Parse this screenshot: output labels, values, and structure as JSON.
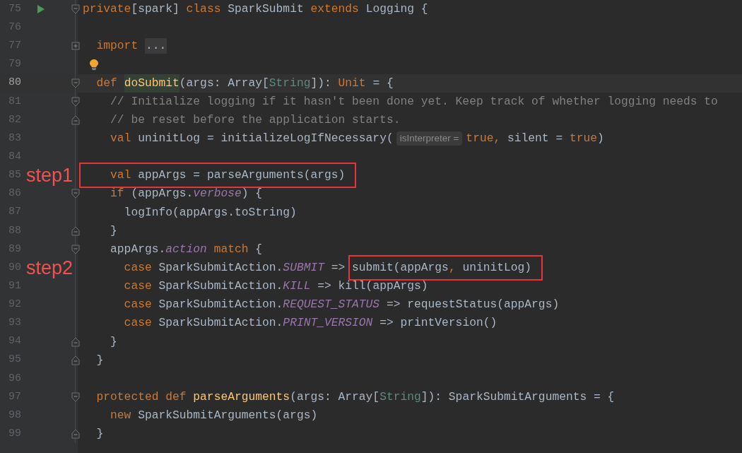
{
  "editor": {
    "lines": [
      {
        "number": "75",
        "current": false,
        "gutter_icon": {
          "kind": "run"
        },
        "fold": {
          "kind": "start"
        },
        "tokens": [
          {
            "kind": "kw",
            "text": "private"
          },
          {
            "kind": "plain",
            "text": "[spark] "
          },
          {
            "kind": "kw",
            "text": "class "
          },
          {
            "kind": "plain",
            "text": "SparkSubmit "
          },
          {
            "kind": "kw",
            "text": "extends "
          },
          {
            "kind": "plain",
            "text": "Logging {"
          }
        ]
      },
      {
        "number": "76",
        "current": false
      },
      {
        "number": "77",
        "current": false,
        "fold": {
          "kind": "collapsed"
        },
        "tokens": [
          {
            "kind": "kw",
            "text": "  import "
          },
          {
            "kind": "folded",
            "text": "..."
          }
        ]
      },
      {
        "number": "79",
        "current": false,
        "code_icon": {
          "kind": "bulb"
        }
      },
      {
        "number": "80",
        "current": true,
        "fold": {
          "kind": "start"
        },
        "tokens": [
          {
            "kind": "kw",
            "text": "  def "
          },
          {
            "kind": "decl",
            "text": "doSubmit",
            "highlighted": true
          },
          {
            "kind": "plain",
            "text": "(args: Array["
          },
          {
            "kind": "type",
            "text": "String"
          },
          {
            "kind": "plain",
            "text": "]): "
          },
          {
            "kind": "kw",
            "text": "Unit"
          },
          {
            "kind": "plain",
            "text": " = {"
          }
        ]
      },
      {
        "number": "81",
        "current": false,
        "fold": {
          "kind": "start"
        },
        "tokens": [
          {
            "kind": "comment",
            "text": "    // Initialize logging if it hasn't been done yet. Keep track of whether logging needs to"
          }
        ]
      },
      {
        "number": "82",
        "current": false,
        "fold": {
          "kind": "end"
        },
        "tokens": [
          {
            "kind": "comment",
            "text": "    // be reset before the application starts."
          }
        ]
      },
      {
        "number": "83",
        "current": false,
        "tokens": [
          {
            "kind": "kw",
            "text": "    val "
          },
          {
            "kind": "plain",
            "text": "uninitLog = initializeLogIfNecessary("
          },
          {
            "kind": "hint",
            "text": "isInterpreter ="
          },
          {
            "kind": "kw",
            "text": "true,"
          },
          {
            "kind": "plain",
            "text": " silent = "
          },
          {
            "kind": "kw",
            "text": "true"
          },
          {
            "kind": "plain",
            "text": ")"
          }
        ]
      },
      {
        "number": "84",
        "current": false
      },
      {
        "number": "85",
        "current": false,
        "callout": {
          "label": "step1"
        },
        "tokens": [
          {
            "kind": "kw",
            "text": "    val ",
            "boxed": true
          },
          {
            "kind": "plain",
            "text": "appArgs = parseArguments(args)",
            "boxed": true
          }
        ]
      },
      {
        "number": "86",
        "current": false,
        "fold": {
          "kind": "start"
        },
        "tokens": [
          {
            "kind": "kw",
            "text": "    if "
          },
          {
            "kind": "plain",
            "text": "(appArgs."
          },
          {
            "kind": "field",
            "text": "verbose"
          },
          {
            "kind": "plain",
            "text": ") {"
          }
        ]
      },
      {
        "number": "87",
        "current": false,
        "tokens": [
          {
            "kind": "plain",
            "text": "      logInfo(appArgs.toString)"
          }
        ]
      },
      {
        "number": "88",
        "current": false,
        "fold": {
          "kind": "end"
        },
        "tokens": [
          {
            "kind": "plain",
            "text": "    }"
          }
        ]
      },
      {
        "number": "89",
        "current": false,
        "fold": {
          "kind": "start"
        },
        "tokens": [
          {
            "kind": "plain",
            "text": "    appArgs."
          },
          {
            "kind": "field",
            "text": "action"
          },
          {
            "kind": "kw",
            "text": " match"
          },
          {
            "kind": "plain",
            "text": " {"
          }
        ]
      },
      {
        "number": "90",
        "current": false,
        "callout": {
          "label": "step2"
        },
        "tokens": [
          {
            "kind": "kw",
            "text": "      case "
          },
          {
            "kind": "plain",
            "text": "SparkSubmitAction."
          },
          {
            "kind": "field",
            "text": "SUBMIT"
          },
          {
            "kind": "plain",
            "text": " => "
          },
          {
            "kind": "plain",
            "text": "submit(appArgs",
            "boxed": true
          },
          {
            "kind": "kw",
            "text": ",",
            "boxed": true
          },
          {
            "kind": "plain",
            "text": " uninitLog)",
            "boxed": true
          }
        ]
      },
      {
        "number": "91",
        "current": false,
        "tokens": [
          {
            "kind": "kw",
            "text": "      case "
          },
          {
            "kind": "plain",
            "text": "SparkSubmitAction."
          },
          {
            "kind": "field",
            "text": "KILL"
          },
          {
            "kind": "plain",
            "text": " => kill(appArgs)"
          }
        ]
      },
      {
        "number": "92",
        "current": false,
        "tokens": [
          {
            "kind": "kw",
            "text": "      case "
          },
          {
            "kind": "plain",
            "text": "SparkSubmitAction."
          },
          {
            "kind": "field",
            "text": "REQUEST_STATUS"
          },
          {
            "kind": "plain",
            "text": " => requestStatus(appArgs)"
          }
        ]
      },
      {
        "number": "93",
        "current": false,
        "tokens": [
          {
            "kind": "kw",
            "text": "      case "
          },
          {
            "kind": "plain",
            "text": "SparkSubmitAction."
          },
          {
            "kind": "field",
            "text": "PRINT_VERSION"
          },
          {
            "kind": "plain",
            "text": " => printVersion()"
          }
        ]
      },
      {
        "number": "94",
        "current": false,
        "fold": {
          "kind": "end"
        },
        "tokens": [
          {
            "kind": "plain",
            "text": "    }"
          }
        ]
      },
      {
        "number": "95",
        "current": false,
        "fold": {
          "kind": "end"
        },
        "tokens": [
          {
            "kind": "plain",
            "text": "  }"
          }
        ]
      },
      {
        "number": "96",
        "current": false
      },
      {
        "number": "97",
        "current": false,
        "fold": {
          "kind": "start"
        },
        "tokens": [
          {
            "kind": "kw",
            "text": "  protected def "
          },
          {
            "kind": "decl",
            "text": "parseArguments"
          },
          {
            "kind": "plain",
            "text": "(args: Array["
          },
          {
            "kind": "type",
            "text": "String"
          },
          {
            "kind": "plain",
            "text": "]): SparkSubmitArguments = {"
          }
        ]
      },
      {
        "number": "98",
        "current": false,
        "tokens": [
          {
            "kind": "kw",
            "text": "    new "
          },
          {
            "kind": "plain",
            "text": "SparkSubmitArguments(args)"
          }
        ]
      },
      {
        "number": "99",
        "current": false,
        "fold": {
          "kind": "end"
        },
        "tokens": [
          {
            "kind": "plain",
            "text": "  }"
          }
        ]
      }
    ]
  }
}
